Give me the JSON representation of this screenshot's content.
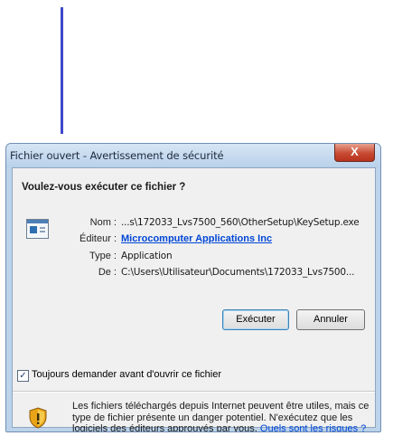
{
  "dialog": {
    "title": "Fichier ouvert - Avertissement de sécurité",
    "close_glyph": "X",
    "question": "Voulez-vous exécuter ce fichier ?",
    "fields": {
      "name_label": "Nom :",
      "name_value": "...s\\172033_Lvs7500_560\\OtherSetup\\KeySetup.exe",
      "publisher_label": "Éditeur :",
      "publisher_value": "Microcomputer Applications Inc",
      "type_label": "Type :",
      "type_value": "Application",
      "from_label": "De :",
      "from_value": "C:\\Users\\Utilisateur\\Documents\\172033_Lvs7500..."
    },
    "buttons": {
      "run": "Exécuter",
      "cancel": "Annuler"
    },
    "checkbox": {
      "checked": true,
      "mark": "✓",
      "label": "Toujours demander avant d'ouvrir ce fichier"
    },
    "warning": {
      "text": "Les fichiers téléchargés depuis Internet peuvent être utiles, mais ce type de fichier présente un danger potentiel. N'exécutez que les logiciels des éditeurs approuvés par vous.",
      "link": "Quels sont les risques ?"
    }
  },
  "colors": {
    "annotation_line": "#3f48cc",
    "link": "#0046d5",
    "close_button": "#c84b33"
  },
  "icons": {
    "file": "application-file-icon",
    "warning": "security-shield-icon",
    "close": "close-icon"
  }
}
